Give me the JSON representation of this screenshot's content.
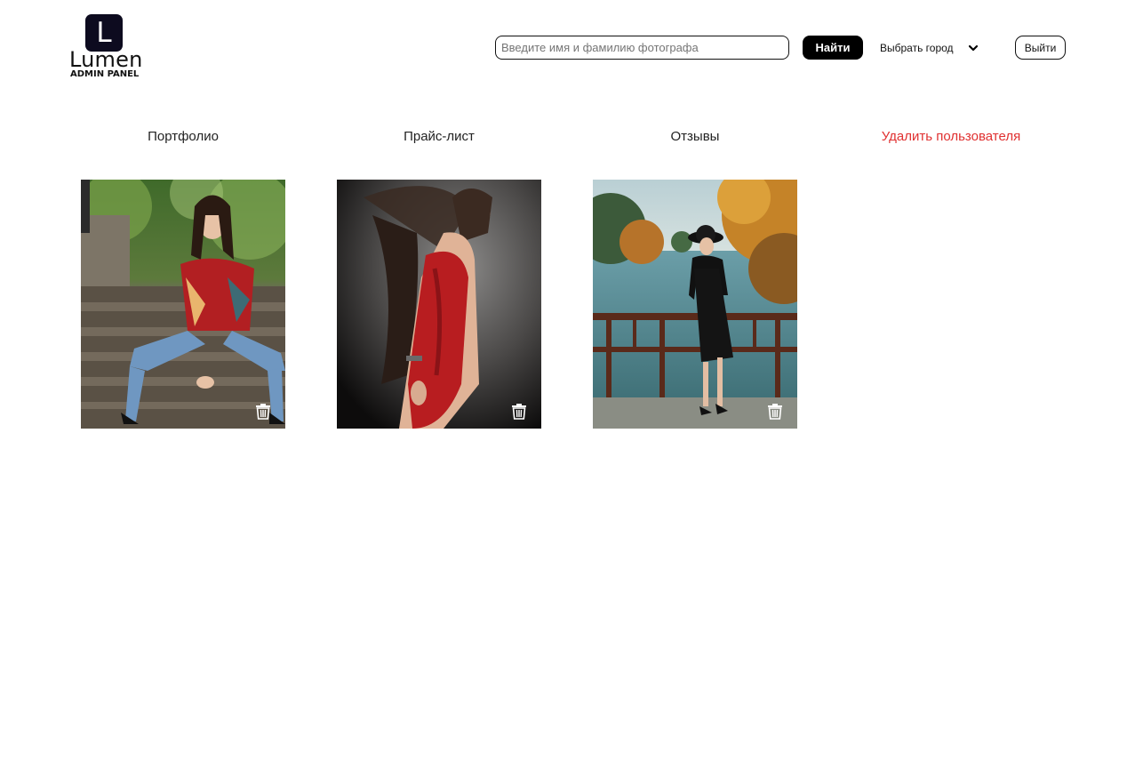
{
  "logo": {
    "mark": "L",
    "name": "Lumen",
    "subtitle": "ADMIN PANEL"
  },
  "header": {
    "search_placeholder": "Введите имя и фамилию фотографа",
    "search_value": "",
    "find_label": "Найти",
    "city_label": "Выбрать город",
    "logout_label": "Выйти"
  },
  "tabs": [
    {
      "label": "Портфолио"
    },
    {
      "label": "Прайс-лист"
    },
    {
      "label": "Отзывы"
    },
    {
      "label": "Удалить пользователя",
      "color": "#e03030"
    }
  ],
  "gallery": {
    "photos": [
      {
        "icon": "trash-icon"
      },
      {
        "icon": "trash-icon"
      },
      {
        "icon": "trash-icon"
      }
    ]
  },
  "colors": {
    "accent": "#000000",
    "danger": "#e03030",
    "logo_mark": "#0d0b1f"
  }
}
